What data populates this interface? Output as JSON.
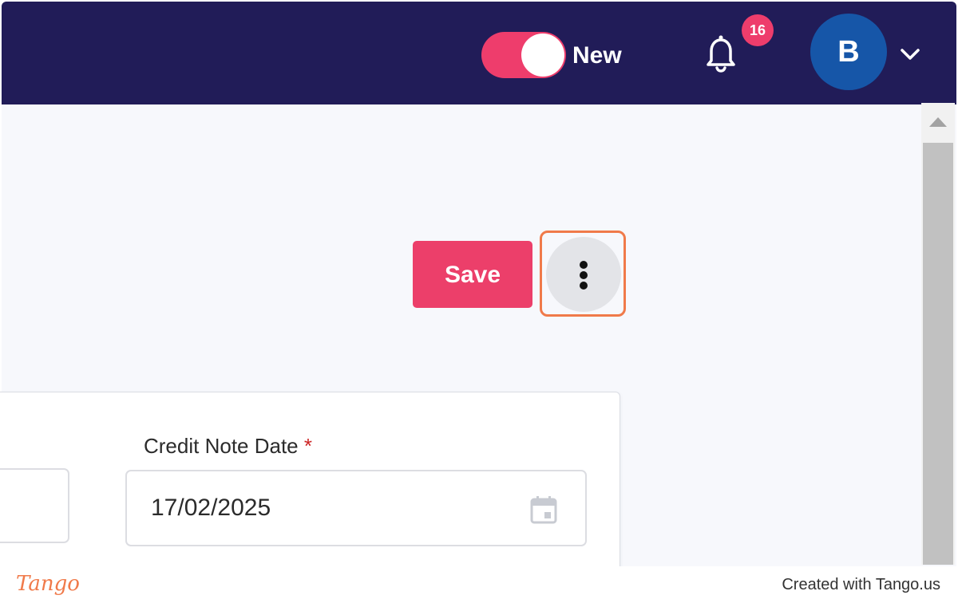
{
  "header": {
    "toggle": {
      "label": "New",
      "state": "on",
      "color": "#ee3d6c"
    },
    "notifications": {
      "icon": "bell-icon",
      "count": "16",
      "badge_color": "#ee3d6c"
    },
    "user": {
      "initial": "B",
      "avatar_color": "#1656a8",
      "menu_icon": "chevron-down-icon"
    },
    "background_color": "#211c58"
  },
  "toolbar": {
    "save_label": "Save",
    "save_color": "#ec3f6a",
    "more_icon": "more-vertical-icon"
  },
  "form": {
    "credit_note_date": {
      "label": "Credit Note Date",
      "required_marker": "*",
      "value": "17/02/2025",
      "icon": "calendar-icon"
    }
  },
  "footer": {
    "brand": "Tango",
    "credit": "Created with Tango.us",
    "accent_color": "#f07a4a"
  }
}
